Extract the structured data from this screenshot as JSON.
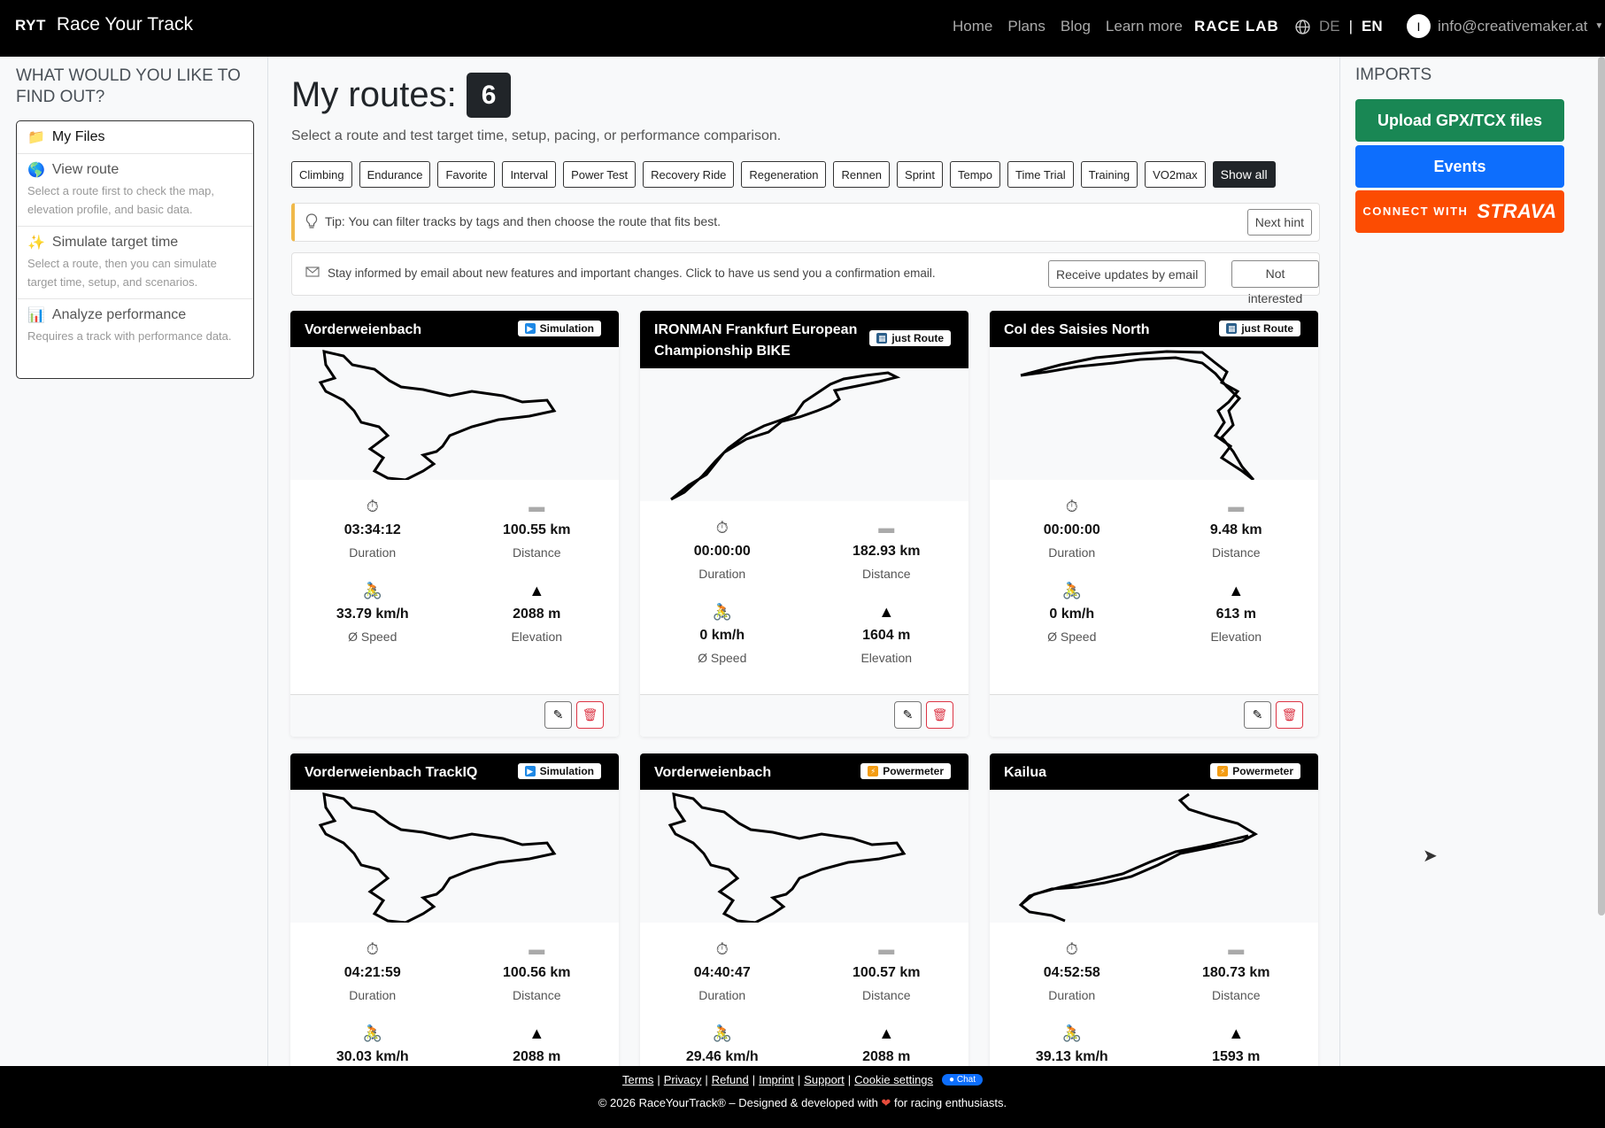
{
  "nav": {
    "brand_mark": "RYT",
    "brand_name": "Race Your Track",
    "links": [
      "Home",
      "Plans",
      "Blog",
      "Learn more"
    ],
    "race_lab": "RACE LAB",
    "lang_de": "DE",
    "lang_sep": "|",
    "lang_en": "EN",
    "user_initial": "I",
    "user_email": "info@creativemaker.at"
  },
  "left": {
    "heading": "WHAT WOULD YOU LIKE TO FIND OUT?",
    "items": [
      {
        "icon": "📁",
        "title": "My Files",
        "desc": ""
      },
      {
        "icon": "🌎",
        "title": "View route",
        "desc": "Select a route first to check the map, elevation profile, and basic data."
      },
      {
        "icon": "✨",
        "title": "Simulate target time",
        "desc": "Select a route, then you can simulate target time, setup, and scenarios."
      },
      {
        "icon": "📊",
        "title": "Analyze performance",
        "desc": "Requires a track with performance data."
      }
    ]
  },
  "main": {
    "title": "My routes:",
    "count": "6",
    "subtitle": "Select a route and test target time, setup, pacing, or performance comparison.",
    "tags": [
      "Climbing",
      "Endurance",
      "Favorite",
      "Interval",
      "Power Test",
      "Recovery Ride",
      "Regeneration",
      "Rennen",
      "Sprint",
      "Tempo",
      "Time Trial",
      "Training",
      "VO2max"
    ],
    "show_all": "Show all",
    "tip": "Tip: You can filter tracks by tags and then choose the route that fits best.",
    "next_hint": "Next hint",
    "news": "Stay informed by email about new features and important changes. Click to have us send you a confirmation email.",
    "receive_updates": "Receive updates by email",
    "not_interested": "Not interested"
  },
  "labels": {
    "duration": "Duration",
    "distance": "Distance",
    "speed": "Ø Speed",
    "elevation": "Elevation"
  },
  "cards": [
    {
      "title": "Vorderweienbach",
      "badge": "Simulation",
      "badge_color": "#1e88e5",
      "duration": "03:34:12",
      "distance": "100.55 km",
      "speed": "33.79 km/h",
      "elevation": "2088 m"
    },
    {
      "title": "IRONMAN Frankfurt European Championship BIKE",
      "badge": "just Route",
      "badge_color": "#2c5f8a",
      "duration": "00:00:00",
      "distance": "182.93 km",
      "speed": "0 km/h",
      "elevation": "1604 m"
    },
    {
      "title": "Col des Saisies North",
      "badge": "just Route",
      "badge_color": "#2c5f8a",
      "duration": "00:00:00",
      "distance": "9.48 km",
      "speed": "0 km/h",
      "elevation": "613 m"
    },
    {
      "title": "Vorderweienbach TrackIQ",
      "badge": "Simulation",
      "badge_color": "#1e88e5",
      "duration": "04:21:59",
      "distance": "100.56 km",
      "speed": "30.03 km/h",
      "elevation": "2088 m"
    },
    {
      "title": "Vorderweienbach",
      "badge": "Powermeter",
      "badge_color": "#f39c12",
      "duration": "04:40:47",
      "distance": "100.57 km",
      "speed": "29.46 km/h",
      "elevation": "2088 m"
    },
    {
      "title": "Kailua",
      "badge": "Powermeter",
      "badge_color": "#f39c12",
      "duration": "04:52:58",
      "distance": "180.73 km",
      "speed": "39.13 km/h",
      "elevation": "1593 m"
    }
  ],
  "right": {
    "heading": "IMPORTS",
    "upload": "Upload GPX/TCX files",
    "events": "Events",
    "connect_with": "CONNECT WITH",
    "strava": "STRAVA",
    "colors": {
      "upload": "#198754",
      "events": "#0d6efd",
      "strava": "#fc4c02"
    }
  },
  "footer": {
    "links": [
      "Terms",
      "Privacy",
      "Refund",
      "Imprint",
      "Support",
      "Cookie settings"
    ],
    "chat": "Chat",
    "copy_pre": "© 2026 RaceYourTrack® – Designed & developed with",
    "copy_post": "for racing enthusiasts."
  }
}
